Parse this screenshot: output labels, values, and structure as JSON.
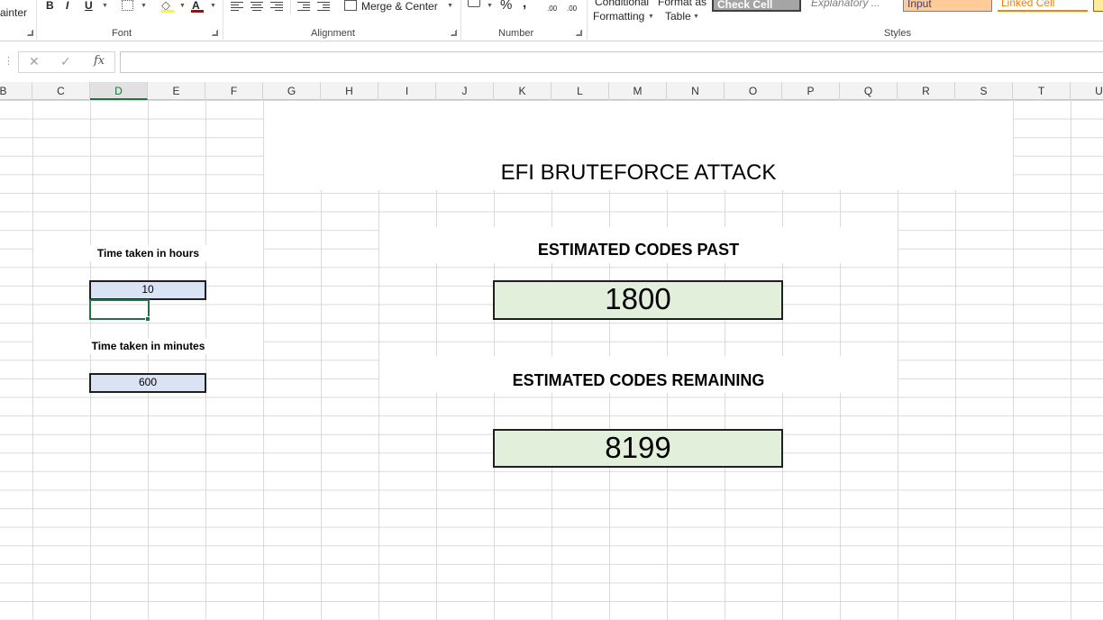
{
  "ribbon": {
    "clipboard": {
      "format_painter_label": "ainter"
    },
    "font": {
      "bold_label": "B",
      "italic_label": "I",
      "underline_label": "U",
      "font_color_label": "A",
      "group_label": "Font",
      "font_color": "#c00000"
    },
    "alignment": {
      "merge_center_label": "Merge & Center",
      "group_label": "Alignment"
    },
    "number": {
      "percent_label": "%",
      "comma_label": ",",
      "increase_decimal_label": ".00",
      "decrease_decimal_label": ".00",
      "group_label": "Number"
    },
    "styles": {
      "conditional_line1": "Conditional",
      "conditional_line2": "Formatting",
      "format_as_line1": "Format as",
      "format_as_line2": "Table",
      "cell_styles": [
        {
          "label": "Check Cell",
          "bg": "#a5a5a5",
          "color": "#ffffff"
        },
        {
          "label": "Explanatory ...",
          "bg": "#ffffff",
          "color": "#7f7f7f"
        },
        {
          "label": "Input",
          "bg": "#ffcc99",
          "color": "#3f3f76"
        },
        {
          "label": "Linked Cell",
          "bg": "#ffffff",
          "color": "#fa7d00"
        }
      ],
      "group_label": "Styles"
    }
  },
  "formula_bar": {
    "cancel_icon": "close-icon",
    "enter_icon": "check-icon",
    "fx_label": "fx",
    "value": ""
  },
  "columns": [
    "B",
    "C",
    "D",
    "E",
    "F",
    "G",
    "H",
    "I",
    "J",
    "K",
    "L",
    "M",
    "N",
    "O",
    "P",
    "Q",
    "R",
    "S",
    "T",
    "U"
  ],
  "active_column": "D",
  "sheet": {
    "hours_label": "Time taken in hours",
    "hours_value": "10",
    "minutes_label": "Time taken in minutes",
    "minutes_value": "600",
    "title": "EFI BRUTEFORCE ATTACK",
    "codes_past_label": "ESTIMATED CODES PAST",
    "codes_past_value": "1800",
    "codes_remaining_label": "ESTIMATED CODES REMAINING",
    "codes_remaining_value": "8199"
  },
  "colors": {
    "accent": "#217346",
    "input_fill": "#dae3f3",
    "result_fill": "#e2efda"
  }
}
